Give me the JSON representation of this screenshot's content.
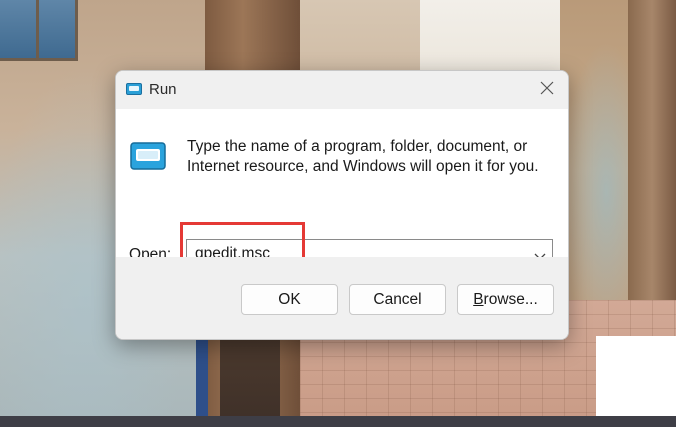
{
  "dialog": {
    "title": "Run",
    "instructions": "Type the name of a program, folder, document, or Internet resource, and Windows will open it for you.",
    "open_label_access_key": "O",
    "open_label_rest": "pen:",
    "open_value": "gpedit.msc",
    "buttons": {
      "ok": "OK",
      "cancel": "Cancel",
      "browse_access_key": "B",
      "browse_rest": "rowse..."
    },
    "icons": {
      "title": "run-icon",
      "large": "run-icon",
      "close": "close-icon",
      "dropdown": "chevron-down-icon"
    }
  },
  "colors": {
    "highlight": "#e53935",
    "dialog_bg": "#ffffff",
    "footer_bg": "#f0f0f0"
  }
}
